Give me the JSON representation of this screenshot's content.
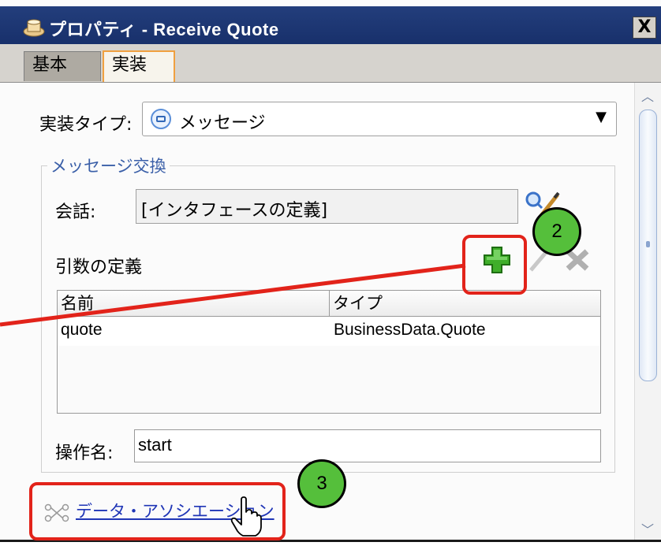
{
  "window": {
    "title": "プロパティ - Receive Quote",
    "close_label": "X"
  },
  "tabs": [
    {
      "label": "基本",
      "active": false
    },
    {
      "label": "実装",
      "active": true
    }
  ],
  "implementation": {
    "type_label": "実装タイプ:",
    "type_value": "メッセージ"
  },
  "message_exchange": {
    "legend": "メッセージ交換",
    "conversation_label": "会話:",
    "conversation_value": "[インタフェースの定義]",
    "arguments_label": "引数の定義",
    "table": {
      "columns": [
        "名前",
        "タイプ"
      ],
      "rows": [
        {
          "name": "quote",
          "type": "BusinessData.Quote"
        }
      ]
    },
    "operation_label": "操作名:",
    "operation_value": "start"
  },
  "data_association_link": "データ・アソシエーション",
  "annotations": {
    "step_2": "2",
    "step_3": "3",
    "highlight_color": "#e2231a",
    "badge_color": "#55bf3b"
  },
  "icons": {
    "title": "process-icon",
    "message": "message-icon",
    "search": "search-icon",
    "edit": "pencil-icon",
    "add": "plus-icon",
    "delete": "delete-icon",
    "association": "association-icon",
    "cursor": "hand-cursor-icon"
  }
}
